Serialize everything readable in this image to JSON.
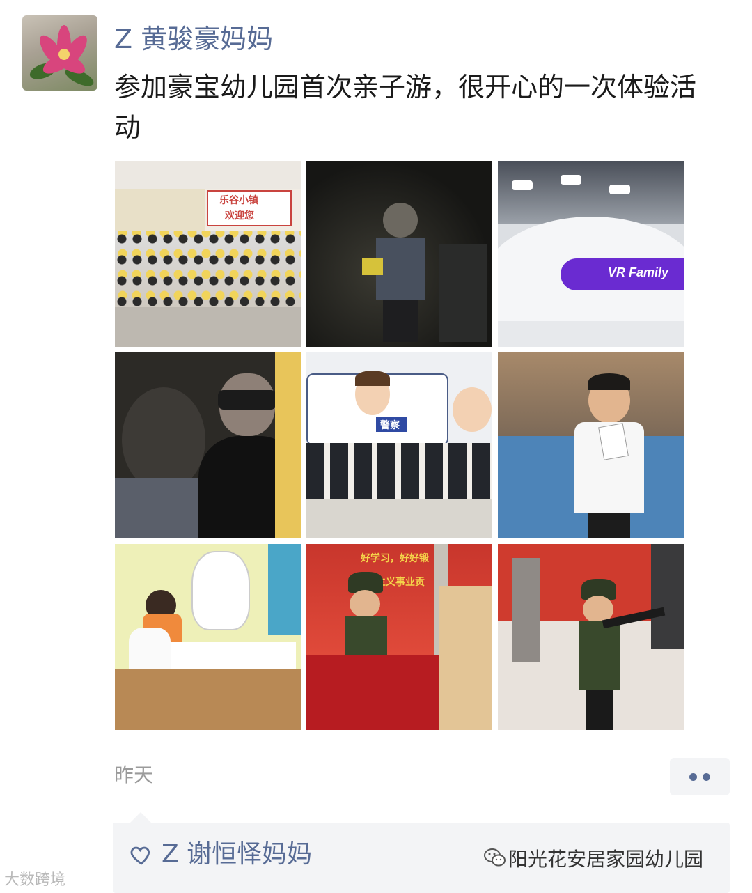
{
  "post": {
    "author": "Z  黄骏豪妈妈",
    "text": "参加豪宝幼儿园首次亲子游，很开心的一次体验活动",
    "time": "昨天",
    "more_icon": "more-dots-icon"
  },
  "photos": [
    {
      "id": "group-photo",
      "sign_text": "乐谷小镇",
      "sign_text2": "欢迎您"
    },
    {
      "id": "dark-cave-photo"
    },
    {
      "id": "vr-ride-photo",
      "label": "VR Family"
    },
    {
      "id": "vr-headset-photo"
    },
    {
      "id": "police-car-photo",
      "label": "警察"
    },
    {
      "id": "boy-card-photo"
    },
    {
      "id": "dentist-photo"
    },
    {
      "id": "soldier-flag-photo",
      "banner_text": "好学习，好好锻",
      "banner_text2": "主义事业贡"
    },
    {
      "id": "soldier-gun-photo"
    }
  ],
  "likes": {
    "icon": "heart-icon",
    "names": "Z  谢恒怿妈妈"
  },
  "watermarks": {
    "left": "大数跨境",
    "right": "阳光花安居家园幼儿园"
  },
  "colors": {
    "name_link": "#576b95",
    "likes_bg": "#f3f4f6",
    "time_gray": "#9b9b9b"
  }
}
